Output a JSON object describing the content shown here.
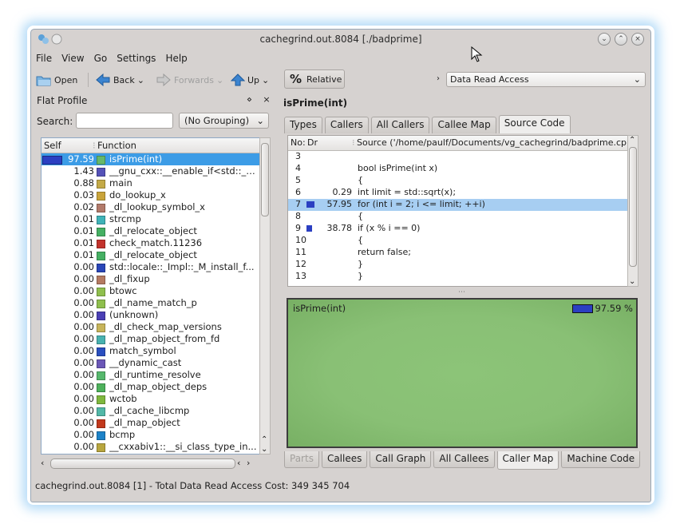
{
  "window": {
    "title": "cachegrind.out.8084 [./badprime]"
  },
  "menu": [
    "File",
    "View",
    "Go",
    "Settings",
    "Help"
  ],
  "toolbar": {
    "open": "Open",
    "back": "Back",
    "forwards": "Forwards",
    "up": "Up",
    "relative": "Relative",
    "event_type": "Data Read Access"
  },
  "flat_profile": {
    "title": "Flat Profile",
    "search_label": "Search:",
    "search_value": "",
    "grouping": "(No Grouping)",
    "col_self": "Self",
    "col_function": "Function",
    "rows": [
      {
        "self": "97.59",
        "fn": "isPrime(int)",
        "color": "#66b96a"
      },
      {
        "self": "1.43",
        "fn": "__gnu_cxx::__enable_if<std::__...",
        "color": "#5552b8"
      },
      {
        "self": "0.88",
        "fn": "main",
        "color": "#c4aa47"
      },
      {
        "self": "0.03",
        "fn": "do_lookup_x",
        "color": "#c9a43a"
      },
      {
        "self": "0.02",
        "fn": "_dl_lookup_symbol_x",
        "color": "#b27a6a"
      },
      {
        "self": "0.01",
        "fn": "strcmp",
        "color": "#3fb3b8"
      },
      {
        "self": "0.01",
        "fn": "_dl_relocate_object",
        "color": "#45b063"
      },
      {
        "self": "0.01",
        "fn": "check_match.11236",
        "color": "#c3332c"
      },
      {
        "self": "0.01",
        "fn": "_dl_relocate_object",
        "color": "#45b063"
      },
      {
        "self": "0.00",
        "fn": "std::locale::_Impl::_M_install_f...",
        "color": "#2946b8"
      },
      {
        "self": "0.00",
        "fn": "_dl_fixup",
        "color": "#b57a62"
      },
      {
        "self": "0.00",
        "fn": "btowc",
        "color": "#8fbf4d"
      },
      {
        "self": "0.00",
        "fn": "_dl_name_match_p",
        "color": "#8fbf4d"
      },
      {
        "self": "0.00",
        "fn": "(unknown)",
        "color": "#4a3fb5"
      },
      {
        "self": "0.00",
        "fn": "_dl_check_map_versions",
        "color": "#c7b45a"
      },
      {
        "self": "0.00",
        "fn": "_dl_map_object_from_fd",
        "color": "#48b2b0"
      },
      {
        "self": "0.00",
        "fn": "match_symbol",
        "color": "#2a4fc0"
      },
      {
        "self": "0.00",
        "fn": "__dynamic_cast",
        "color": "#6b57b7"
      },
      {
        "self": "0.00",
        "fn": "_dl_runtime_resolve",
        "color": "#56b86c"
      },
      {
        "self": "0.00",
        "fn": "_dl_map_object_deps",
        "color": "#4db15b"
      },
      {
        "self": "0.00",
        "fn": "wctob",
        "color": "#7fb83e"
      },
      {
        "self": "0.00",
        "fn": "_dl_cache_libcmp",
        "color": "#52b8a8"
      },
      {
        "self": "0.00",
        "fn": "_dl_map_object",
        "color": "#c2381c"
      },
      {
        "self": "0.00",
        "fn": "bcmp",
        "color": "#1c82c8"
      },
      {
        "self": "0.00",
        "fn": "__cxxabiv1::__si_class_type_in...",
        "color": "#b8a63e"
      }
    ],
    "self_bar_fraction": 0.9759
  },
  "detail": {
    "title": "isPrime(int)",
    "tabs_top": [
      "Types",
      "Callers",
      "All Callers",
      "Callee Map",
      "Source Code"
    ],
    "active_top": "Source Code",
    "source": {
      "col_no": "No:",
      "col_dr": "Dr",
      "col_source": "Source ('/home/paulf/Documents/vg_cachegrind/badprime.cp",
      "lines": [
        {
          "no": "3",
          "cost": "",
          "code": "",
          "bar": 0
        },
        {
          "no": "4",
          "cost": "",
          "code": "bool isPrime(int x)",
          "bar": 0
        },
        {
          "no": "5",
          "cost": "",
          "code": "{",
          "bar": 0
        },
        {
          "no": "6",
          "cost": "0.29",
          "code": "int limit = std::sqrt(x);",
          "bar": 0
        },
        {
          "no": "7",
          "cost": "57.95",
          "code": "for (int i = 2; i <= limit; ++i)",
          "bar": 0.5795,
          "selected": true
        },
        {
          "no": "8",
          "cost": "",
          "code": "{",
          "bar": 0
        },
        {
          "no": "9",
          "cost": "38.78",
          "code": "if (x % i == 0)",
          "bar": 0.3878
        },
        {
          "no": "10",
          "cost": "",
          "code": "{",
          "bar": 0
        },
        {
          "no": "11",
          "cost": "",
          "code": "return false;",
          "bar": 0
        },
        {
          "no": "12",
          "cost": "",
          "code": "}",
          "bar": 0
        },
        {
          "no": "13",
          "cost": "",
          "code": "}",
          "bar": 0
        }
      ]
    },
    "map": {
      "label": "isPrime(int)",
      "percent": "97.59 %"
    },
    "tabs_bottom": [
      "Parts",
      "Callees",
      "Call Graph",
      "All Callees",
      "Caller Map",
      "Machine Code"
    ],
    "active_bottom": "Caller Map"
  },
  "status": "cachegrind.out.8084 [1] - Total Data Read Access Cost: 349 345 704"
}
